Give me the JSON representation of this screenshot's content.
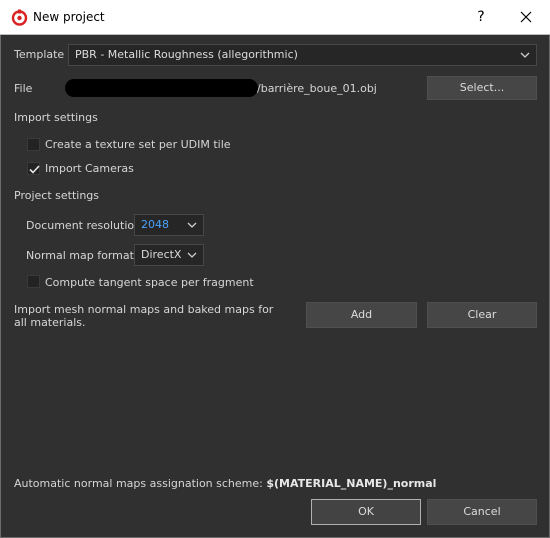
{
  "window": {
    "title": "New project",
    "help_label": "?",
    "close_label": "✕"
  },
  "template": {
    "label": "Template",
    "value": "PBR - Metallic Roughness (allegorithmic)"
  },
  "file": {
    "label": "File",
    "path_suffix": "/barrière_boue_01.obj",
    "select_button": "Select..."
  },
  "import_settings": {
    "heading": "Import settings",
    "udim_label": "Create a texture set per UDIM tile",
    "udim_checked": false,
    "cameras_label": "Import Cameras",
    "cameras_checked": true
  },
  "project_settings": {
    "heading": "Project settings",
    "resolution_label": "Document resolution",
    "resolution_value": "2048",
    "normal_format_label": "Normal map format",
    "normal_format_value": "DirectX",
    "tangent_label": "Compute tangent space per fragment",
    "tangent_checked": false
  },
  "baked_maps": {
    "description": "Import mesh normal maps and baked maps for all materials.",
    "add_button": "Add",
    "clear_button": "Clear"
  },
  "footer": {
    "scheme_label": "Automatic normal maps assignation scheme:",
    "scheme_value": "$(MATERIAL_NAME)_normal",
    "ok_button": "OK",
    "cancel_button": "Cancel"
  },
  "colors": {
    "background": "#303030",
    "field": "#262626",
    "button": "#464646",
    "accent_value": "#4aa3ff",
    "app_icon": "#d92323"
  }
}
